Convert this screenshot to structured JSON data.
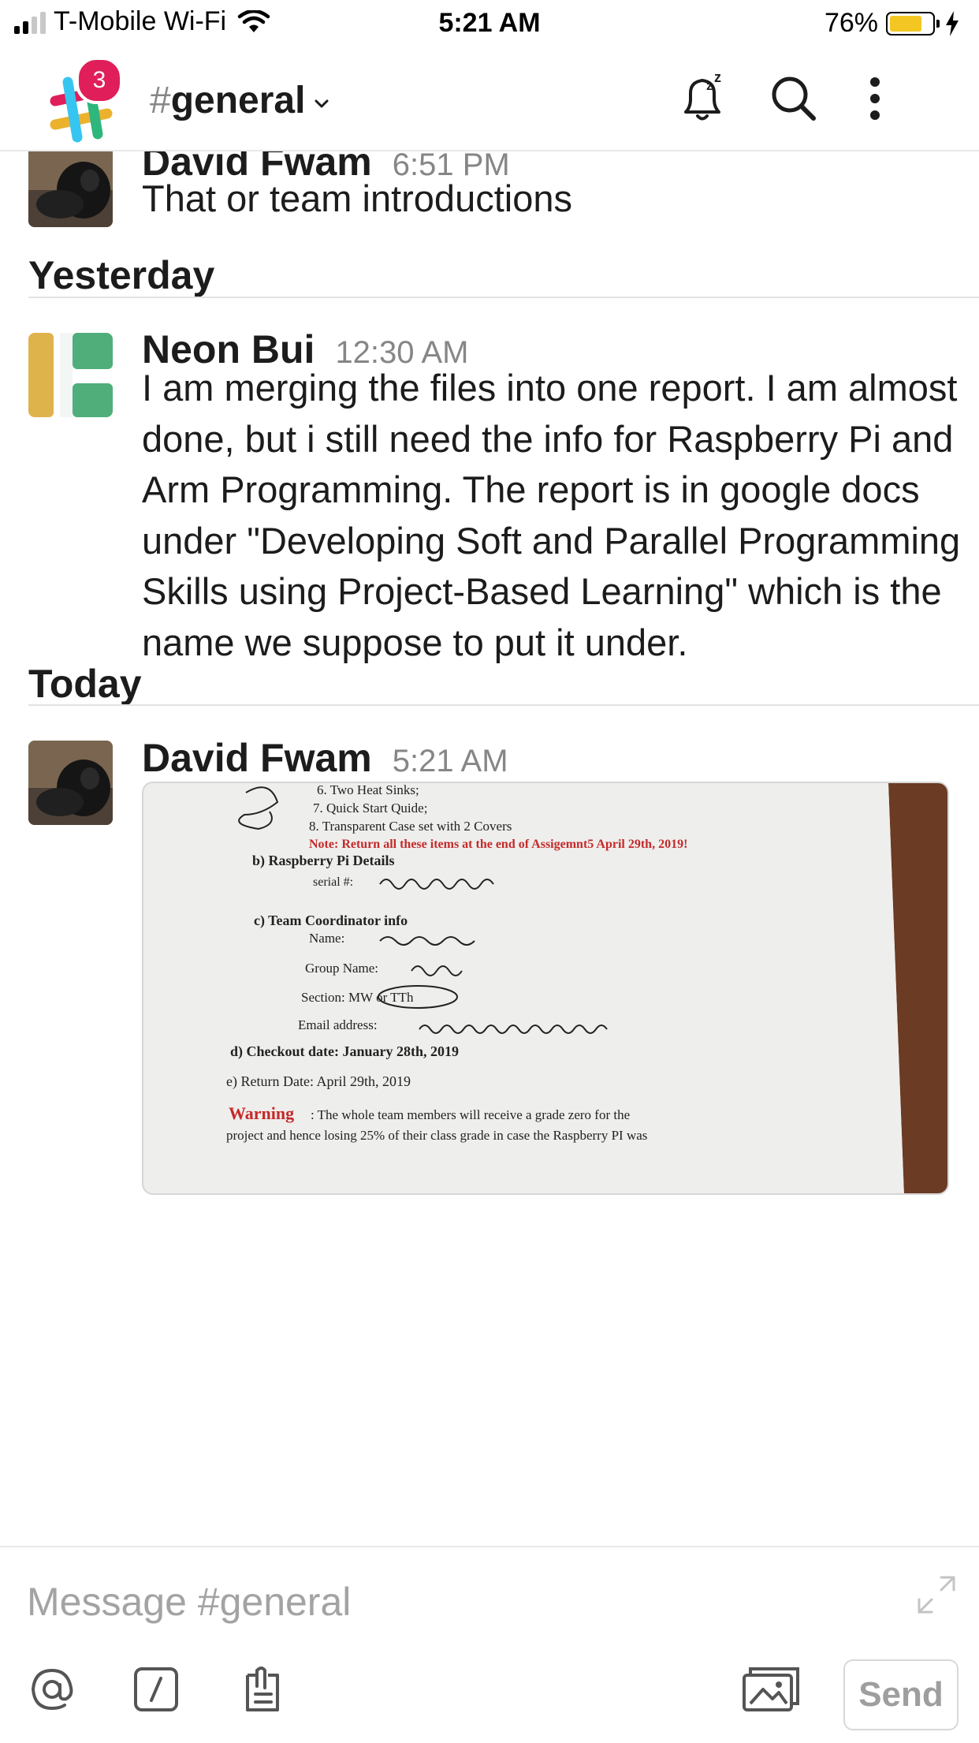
{
  "status_bar": {
    "carrier": "T-Mobile Wi-Fi",
    "time": "5:21 AM",
    "battery_percent": "76%",
    "battery_level": 0.76,
    "signal_bars": 2
  },
  "header": {
    "badge_count": "3",
    "channel_hash": "#",
    "channel_name": "general"
  },
  "messages": [
    {
      "author": "David Fwam",
      "time": "6:51 PM",
      "text": "That or team introductions"
    },
    {
      "author": "Neon Bui",
      "time": "12:30 AM",
      "text": "I am merging the files into one report. I am almost done, but i still need the info for Raspberry Pi and Arm Programming. The report is in google docs under \"Developing Soft and Parallel Programming Skills using Project-Based Learning\" which is the name we suppose to put it under."
    },
    {
      "author": "David Fwam",
      "time": "5:21 AM",
      "attachment": {
        "lines": [
          "6. Two Heat Sinks;",
          "7. Quick Start Quide;",
          "8. Transparent Case set with 2 Covers",
          "Note: Return all these items at the end of Assigemnt5 April 29th, 2019!",
          "b) Raspberry Pi Details",
          "serial #:",
          "c) Team Coordinator info",
          "Name:",
          "Group Name:",
          "Section: MW or TTh",
          "Email address:",
          "d) Checkout date: January 28th, 2019",
          "e) Return Date: April 29th, 2019",
          "Warning",
          ": The whole team members will receive a grade zero for the",
          "project and hence losing 25% of their class grade in case the Raspberry PI was"
        ]
      }
    }
  ],
  "day_dividers": [
    "Yesterday",
    "Today"
  ],
  "composer": {
    "placeholder": "Message #general",
    "send_label": "Send"
  },
  "colors": {
    "badge": "#e01e5a",
    "battery": "#f3c623",
    "note_red": "#c42a2a"
  }
}
